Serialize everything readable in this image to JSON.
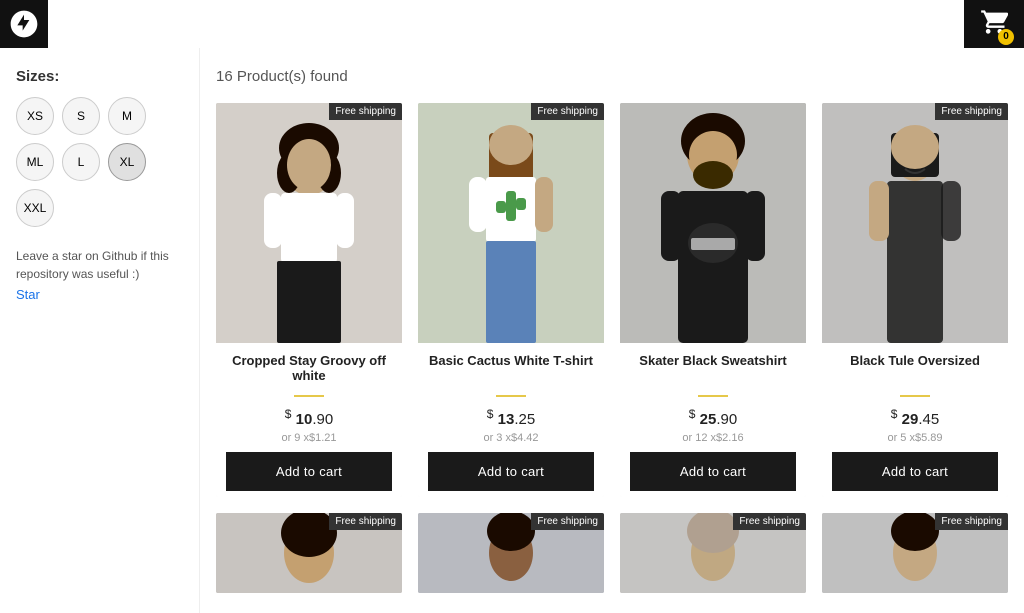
{
  "header": {
    "cart_count": "0"
  },
  "sidebar": {
    "sizes_label": "Sizes:",
    "sizes": [
      {
        "label": "XS",
        "active": false
      },
      {
        "label": "S",
        "active": false
      },
      {
        "label": "M",
        "active": false
      },
      {
        "label": "ML",
        "active": false
      },
      {
        "label": "L",
        "active": false
      },
      {
        "label": "XL",
        "active": true
      },
      {
        "label": "XXL",
        "active": false
      }
    ],
    "github_note": "Leave a star on Github if this repository was useful :)",
    "github_link_label": "Star"
  },
  "main": {
    "products_found_label": "16 Product(s) found",
    "add_to_cart_label": "Add to cart",
    "free_shipping_label": "Free shipping",
    "products": [
      {
        "name": "Cropped Stay Groovy off white",
        "price_int": "10",
        "price_dec": "90",
        "installment": "or 9 x$1.21",
        "free_shipping": true,
        "image_bg": "#d0cfc8"
      },
      {
        "name": "Basic Cactus White T-shirt",
        "price_int": "13",
        "price_dec": "25",
        "installment": "or 3 x$4.42",
        "free_shipping": true,
        "image_bg": "#c8d0c0"
      },
      {
        "name": "Skater Black Sweatshirt",
        "price_int": "25",
        "price_dec": "90",
        "installment": "or 12 x$2.16",
        "free_shipping": false,
        "image_bg": "#bbbbb8"
      },
      {
        "name": "Black Tule Oversized",
        "price_int": "29",
        "price_dec": "45",
        "installment": "or 5 x$5.89",
        "free_shipping": true,
        "image_bg": "#c0bfbe"
      }
    ],
    "partial_products": [
      {
        "free_shipping": true,
        "image_bg": "#c8c4c0"
      },
      {
        "free_shipping": true,
        "image_bg": "#b8bac0"
      },
      {
        "free_shipping": true,
        "image_bg": "#c5c4c2"
      },
      {
        "free_shipping": true,
        "image_bg": "#c0c0c0"
      }
    ]
  }
}
